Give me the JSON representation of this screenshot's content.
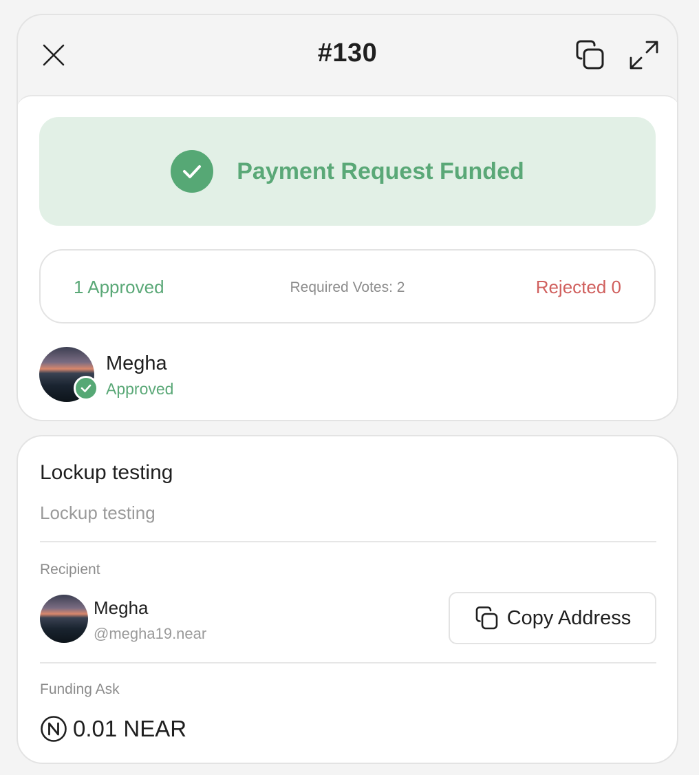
{
  "header": {
    "title": "#130"
  },
  "status_banner": {
    "text": "Payment Request Funded",
    "color": "#5aa877"
  },
  "votes": {
    "approved": "1 Approved",
    "required": "Required Votes: 2",
    "rejected": "Rejected 0"
  },
  "voter": {
    "name": "Megha",
    "status": "Approved"
  },
  "proposal": {
    "title": "Lockup testing",
    "description": "Lockup testing"
  },
  "recipient": {
    "label": "Recipient",
    "name": "Megha",
    "handle": "@megha19.near",
    "copy_label": "Copy Address"
  },
  "funding": {
    "label": "Funding Ask",
    "amount": "0.01 NEAR",
    "token_icon": "near-icon"
  },
  "colors": {
    "approved": "#5aa877",
    "rejected": "#d0605e",
    "banner_bg": "#e2f0e6"
  }
}
